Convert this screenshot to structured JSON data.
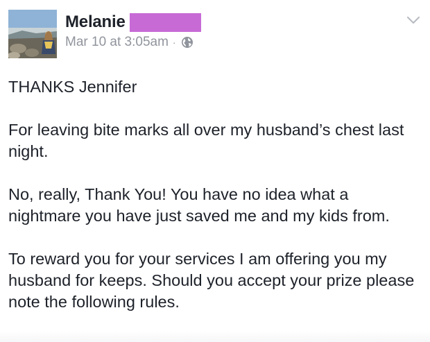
{
  "post": {
    "author": "Melanie",
    "timestamp": "Mar 10 at 3:05am",
    "separator": "·",
    "privacy_icon": "globe-icon",
    "menu_icon": "chevron-down-icon",
    "redaction_color": "#c76ad6",
    "paragraphs": [
      "THANKS Jennifer",
      "For leaving bite marks all over my husband’s chest last night.",
      "No, really, Thank You! You have no idea what a nightmare you have just saved me and my kids from.",
      "To reward you for your services I am offering you my husband for keeps. Should you accept your prize please note the following rules."
    ]
  }
}
